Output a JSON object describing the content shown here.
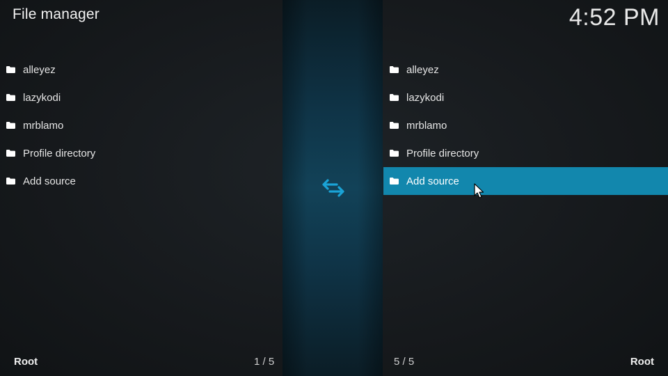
{
  "header": {
    "title": "File manager",
    "clock": "4:52 PM"
  },
  "left_pane": {
    "items": [
      {
        "label": "alleyez",
        "icon": "folder-icon"
      },
      {
        "label": "lazykodi",
        "icon": "folder-icon"
      },
      {
        "label": "mrblamo",
        "icon": "folder-icon"
      },
      {
        "label": "Profile directory",
        "icon": "folder-icon"
      },
      {
        "label": "Add source",
        "icon": "folder-icon"
      }
    ],
    "footer_label": "Root",
    "footer_count": "1 / 5"
  },
  "right_pane": {
    "items": [
      {
        "label": "alleyez",
        "icon": "folder-icon"
      },
      {
        "label": "lazykodi",
        "icon": "folder-icon"
      },
      {
        "label": "mrblamo",
        "icon": "folder-icon"
      },
      {
        "label": "Profile directory",
        "icon": "folder-icon"
      },
      {
        "label": "Add source",
        "icon": "folder-icon",
        "selected": true
      }
    ],
    "footer_label": "Root",
    "footer_count": "5 / 5"
  },
  "center": {
    "icon": "swap-arrows-icon"
  },
  "colors": {
    "accent": "#1287ad",
    "icon_accent": "#1aa3d6",
    "background": "#15191c"
  }
}
